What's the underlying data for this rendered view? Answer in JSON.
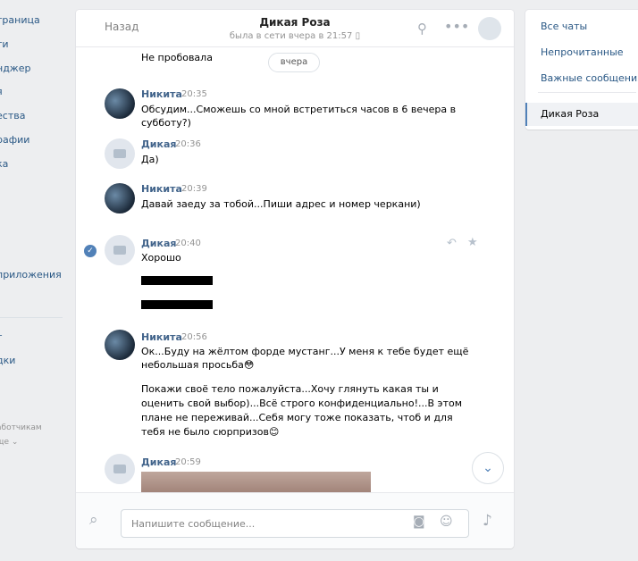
{
  "left_nav": {
    "items": [
      "траница",
      "ти",
      "нджер",
      "я",
      "ества",
      "рафии",
      "ка",
      "",
      "приложения",
      "",
      "т",
      "дки",
      "",
      "аботчикам",
      "ще ⌄"
    ]
  },
  "chat": {
    "back_label": "Назад",
    "peer_name": "Дикая Роза",
    "peer_status": "была в сети вчера в 21:57",
    "date_chip": "вчера",
    "messages": [
      {
        "author": "",
        "time": "",
        "lines": [
          "Не пробовала"
        ]
      },
      {
        "author": "Никита",
        "time": "20:35",
        "lines": [
          "Обсудим...Сможешь со мной встретиться часов в 6 вечера в",
          "субботу?)"
        ]
      },
      {
        "author": "Дикая",
        "time": "20:36",
        "lines": [
          "Да)"
        ]
      },
      {
        "author": "Никита",
        "time": "20:39",
        "lines": [
          "Давай заеду за тобой...Пиши адрес и номер черкани)"
        ]
      },
      {
        "author": "Дикая",
        "time": "20:40",
        "lines": [
          "Хорошо"
        ]
      },
      {
        "author": "Никита",
        "time": "20:56",
        "lines": [
          "Ок...Буду на жёлтом форде мустанг...У меня к тебе будет ещё",
          "небольшая просьба😳"
        ],
        "lines2": [
          "Покажи своё тело пожалуйста...Хочу глянуть какая ты и",
          "оценить свой выбор)...Всё строго конфиденциально!...В этом",
          "плане не переживай...Себя могу тоже показать, чтоб и для",
          "тебя не было сюрпризов😊"
        ]
      },
      {
        "author": "Дикая",
        "time": "20:59",
        "lines": []
      }
    ],
    "composer_placeholder": "Напишите сообщение..."
  },
  "right_nav": {
    "items": [
      "Все чаты",
      "Непрочитанные",
      "Важные сообщения"
    ],
    "active": "Дикая Роза"
  },
  "icons": {
    "search": "search-icon",
    "more": "more-icon",
    "attach": "paperclip-icon",
    "camera": "camera-icon",
    "emoji": "smile-icon",
    "mic": "microphone-icon",
    "reply": "reply-icon",
    "star": "star-icon",
    "scroll": "chevron-down-icon"
  },
  "colors": {
    "link": "#2a5885",
    "author": "#42648b",
    "accent": "#5181b8",
    "bg": "#edeef0"
  }
}
